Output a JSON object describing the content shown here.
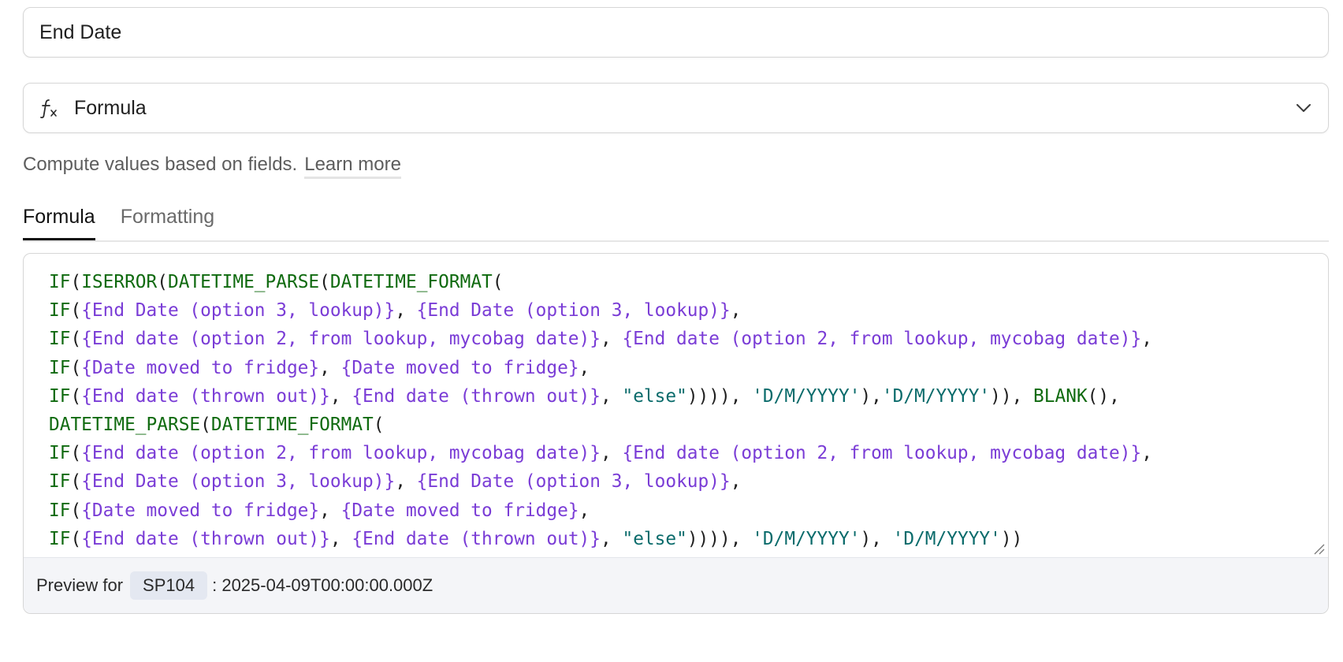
{
  "field_name": {
    "value": "End Date"
  },
  "field_type": {
    "icon": "function-icon",
    "label": "Formula"
  },
  "description": {
    "text": "Compute values based on fields.",
    "link_label": "Learn more"
  },
  "tabs": [
    {
      "label": "Formula",
      "active": true
    },
    {
      "label": "Formatting",
      "active": false
    }
  ],
  "formula_lines": [
    [
      [
        "fn",
        "IF"
      ],
      [
        "p",
        "("
      ],
      [
        "fn",
        "ISERROR"
      ],
      [
        "p",
        "("
      ],
      [
        "fn",
        "DATETIME_PARSE"
      ],
      [
        "p",
        "("
      ],
      [
        "fn",
        "DATETIME_FORMAT"
      ],
      [
        "p",
        "("
      ]
    ],
    [
      [
        "fn",
        "IF"
      ],
      [
        "p",
        "("
      ],
      [
        "fld",
        "{End Date (option 3, lookup)}"
      ],
      [
        "p",
        ", "
      ],
      [
        "fld",
        "{End Date (option 3, lookup)}"
      ],
      [
        "p",
        ","
      ]
    ],
    [
      [
        "fn",
        "IF"
      ],
      [
        "p",
        "("
      ],
      [
        "fld",
        "{End date (option 2, from lookup, mycobag date)}"
      ],
      [
        "p",
        ", "
      ],
      [
        "fld",
        "{End date (option 2, from lookup, mycobag date)}"
      ],
      [
        "p",
        ","
      ]
    ],
    [
      [
        "fn",
        "IF"
      ],
      [
        "p",
        "("
      ],
      [
        "fld",
        "{Date moved to fridge}"
      ],
      [
        "p",
        ", "
      ],
      [
        "fld",
        "{Date moved to fridge}"
      ],
      [
        "p",
        ","
      ]
    ],
    [
      [
        "fn",
        "IF"
      ],
      [
        "p",
        "("
      ],
      [
        "fld",
        "{End date (thrown out)}"
      ],
      [
        "p",
        ", "
      ],
      [
        "fld",
        "{End date (thrown out)}"
      ],
      [
        "p",
        ", "
      ],
      [
        "str",
        "\"else\""
      ],
      [
        "p",
        "))))"
      ],
      [
        "p",
        ", "
      ],
      [
        "str",
        "'D/M/YYYY'"
      ],
      [
        "p",
        "),"
      ],
      [
        "str",
        "'D/M/YYYY'"
      ],
      [
        "p",
        ")), "
      ],
      [
        "fn",
        "BLANK"
      ],
      [
        "p",
        "(),"
      ]
    ],
    [
      [
        "fn",
        "DATETIME_PARSE"
      ],
      [
        "p",
        "("
      ],
      [
        "fn",
        "DATETIME_FORMAT"
      ],
      [
        "p",
        "("
      ]
    ],
    [
      [
        "fn",
        "IF"
      ],
      [
        "p",
        "("
      ],
      [
        "fld",
        "{End date (option 2, from lookup, mycobag date)}"
      ],
      [
        "p",
        ", "
      ],
      [
        "fld",
        "{End date (option 2, from lookup, mycobag date)}"
      ],
      [
        "p",
        ","
      ]
    ],
    [
      [
        "fn",
        "IF"
      ],
      [
        "p",
        "("
      ],
      [
        "fld",
        "{End Date (option 3, lookup)}"
      ],
      [
        "p",
        ", "
      ],
      [
        "fld",
        "{End Date (option 3, lookup)}"
      ],
      [
        "p",
        ","
      ]
    ],
    [
      [
        "fn",
        "IF"
      ],
      [
        "p",
        "("
      ],
      [
        "fld",
        "{Date moved to fridge}"
      ],
      [
        "p",
        ", "
      ],
      [
        "fld",
        "{Date moved to fridge}"
      ],
      [
        "p",
        ","
      ]
    ],
    [
      [
        "fn",
        "IF"
      ],
      [
        "p",
        "("
      ],
      [
        "fld",
        "{End date (thrown out)}"
      ],
      [
        "p",
        ", "
      ],
      [
        "fld",
        "{End date (thrown out)}"
      ],
      [
        "p",
        ", "
      ],
      [
        "str",
        "\"else\""
      ],
      [
        "p",
        "))))"
      ],
      [
        "p",
        ", "
      ],
      [
        "str",
        "'D/M/YYYY'"
      ],
      [
        "p",
        "), "
      ],
      [
        "str",
        "'D/M/YYYY'"
      ],
      [
        "p",
        "))"
      ]
    ]
  ],
  "preview": {
    "prefix": "Preview for",
    "record": "SP104",
    "value": ": 2025-04-09T00:00:00.000Z"
  },
  "colors": {
    "function": "#0f6a0f",
    "field": "#7a3cd6",
    "string": "#0a6b6b"
  }
}
